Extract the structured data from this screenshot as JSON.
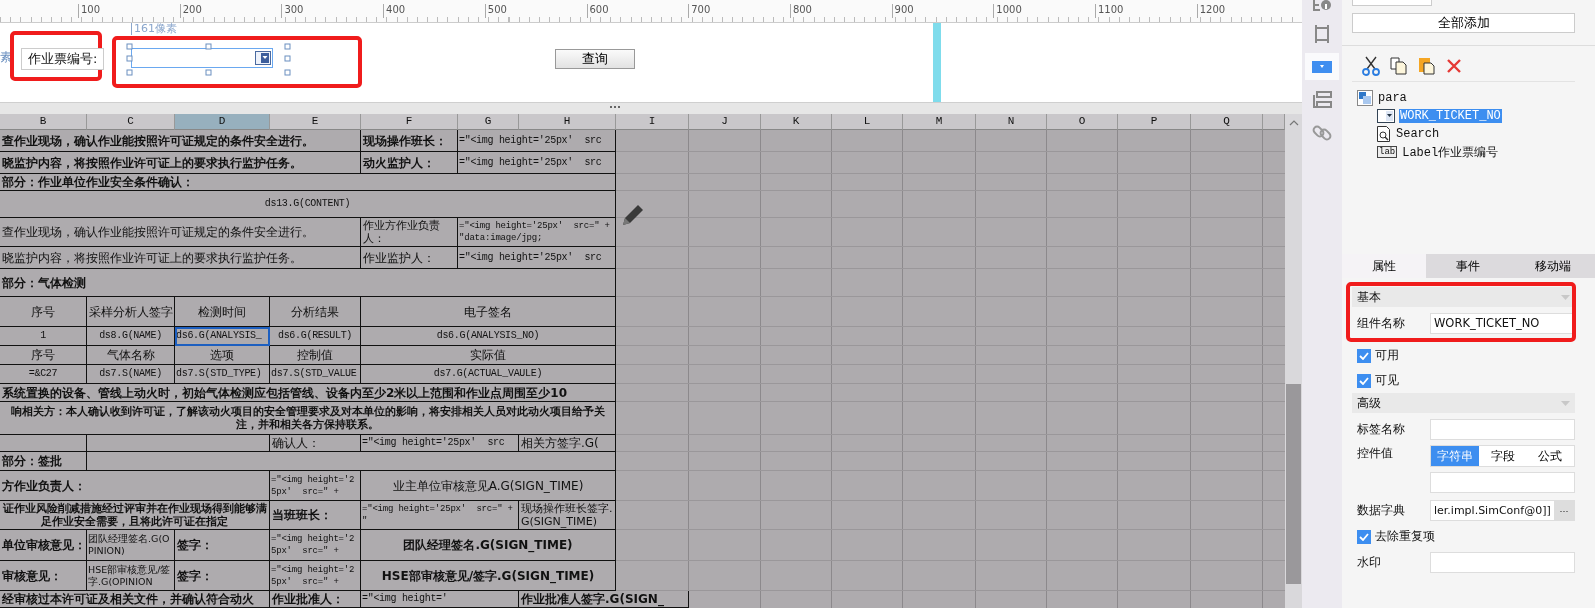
{
  "ruler": {
    "labels": [
      "100",
      "200",
      "300",
      "400",
      "500",
      "600",
      "700",
      "800",
      "900",
      "1000",
      "1100",
      "1200"
    ]
  },
  "canvas": {
    "cut_text": "素",
    "width_hint": "161像素",
    "label": "作业票编号:",
    "button": "查询"
  },
  "sheet": {
    "columns": [
      {
        "label": "B",
        "selected": false
      },
      {
        "label": "C",
        "selected": false
      },
      {
        "label": "D",
        "selected": true
      },
      {
        "label": "E",
        "selected": false
      },
      {
        "label": "F",
        "selected": false
      },
      {
        "label": "G",
        "selected": false
      },
      {
        "label": "H",
        "selected": false
      },
      {
        "label": "I",
        "selected": false
      },
      {
        "label": "J",
        "selected": false
      },
      {
        "label": "K",
        "selected": false
      },
      {
        "label": "L",
        "selected": false
      },
      {
        "label": "M",
        "selected": false
      },
      {
        "label": "N",
        "selected": false
      },
      {
        "label": "O",
        "selected": false
      },
      {
        "label": "P",
        "selected": false
      },
      {
        "label": "Q",
        "selected": false
      }
    ],
    "rows": [
      [
        {
          "text": "查作业现场，确认作业能按照许可证规定的条件安全进行。",
          "selected": false
        },
        {
          "text": "现场操作班长：",
          "selected": false
        },
        {
          "text": "=\"<img height='25px'  src",
          "selected": false
        }
      ],
      [
        {
          "text": "晓监护内容，将按照作业许可证上的要求执行监护任务。",
          "selected": false
        },
        {
          "text": "动火监护人：",
          "selected": false
        },
        {
          "text": "=\"<img height='25px'  src",
          "selected": false
        }
      ],
      [
        {
          "text": "部分：作业单位作业安全条件确认：",
          "selected": false
        }
      ],
      [
        {
          "text": "ds13.G(CONTENT)",
          "selected": false
        }
      ],
      [
        {
          "text": "查作业现场，确认作业能按照许可证规定的条件安全进行。",
          "selected": false
        },
        {
          "text": "作业方作业负责人：",
          "selected": false
        },
        {
          "text": "=\"<img height='25px'  src=\" + \"data:image/jpg;",
          "selected": false
        }
      ],
      [
        {
          "text": "晓监护内容，将按照作业许可证上的要求执行监护任务。",
          "selected": false
        },
        {
          "text": "作业监护人：",
          "selected": false
        },
        {
          "text": "=\"<img height='25px'  src",
          "selected": false
        }
      ],
      [
        {
          "text": "部分：气体检测",
          "selected": false
        }
      ],
      [
        {
          "text": "序号",
          "selected": false
        },
        {
          "text": "采样分析人签字",
          "selected": false
        },
        {
          "text": "检测时间",
          "selected": false
        },
        {
          "text": "分析结果",
          "selected": false
        },
        {
          "text": "电子签名",
          "selected": false
        }
      ],
      [
        {
          "text": "1",
          "selected": false
        },
        {
          "text": "ds8.G(NAME)",
          "selected": false
        },
        {
          "text": "ds6.G(ANALYSIS_",
          "selected": true
        },
        {
          "text": "ds6.G(RESULT)",
          "selected": false
        },
        {
          "text": "ds6.G(ANALYSIS_NO)",
          "selected": false
        }
      ],
      [
        {
          "text": "序号",
          "selected": false
        },
        {
          "text": "气体名称",
          "selected": false
        },
        {
          "text": "选项",
          "selected": false
        },
        {
          "text": "控制值",
          "selected": false
        },
        {
          "text": "实际值",
          "selected": false
        }
      ],
      [
        {
          "text": "=&C27",
          "selected": false
        },
        {
          "text": "ds7.S(NAME)",
          "selected": false
        },
        {
          "text": "ds7.S(STD_TYPE)",
          "selected": false
        },
        {
          "text": "ds7.S(STD_VALUE",
          "selected": false
        },
        {
          "text": "ds7.G(ACTUAL_VAULE)",
          "selected": false
        }
      ],
      [
        {
          "text": "系统置换的设备、管线上动火时，初始气体检测应包括管线、设备内至少2米以上范围和作业点周围至少10",
          "selected": false
        }
      ],
      [
        {
          "text": "响相关方：本人确认收到许可证，了解该动火项目的安全管理要求及对本单位的影响，将安排相关人员对此动火项目给予关注，并和相关各方保持联系。",
          "selected": false
        }
      ],
      [
        {
          "text": "确认人：",
          "selected": false
        },
        {
          "text": "=\"<img height='25px'  src",
          "selected": false
        },
        {
          "text": "相关方签字.G(",
          "selected": false
        }
      ],
      [
        {
          "text": "部分：签批",
          "selected": false
        }
      ],
      [
        {
          "text": "方作业负责人：",
          "selected": false
        },
        {
          "text": "=\"<img height='25px'  src=\" +",
          "selected": false
        },
        {
          "text": "业主单位审核意见A.G(SIGN_TIME)",
          "selected": false
        }
      ],
      [
        {
          "text": "证作业风险削减措施经过评审并在作业现场得到能够满足作业安全需要，且将此许可证在指定",
          "selected": false
        },
        {
          "text": "当班班长：",
          "selected": false
        },
        {
          "text": "=\"<img height='25px'  src=\" + \"",
          "selected": false
        },
        {
          "text": "现场操作班长签字.G(SIGN_TIME)",
          "selected": false
        }
      ],
      [
        {
          "text": "单位审核意见：",
          "selected": false
        },
        {
          "text": "团队经理签名.G(OPINION)",
          "selected": false
        },
        {
          "text": "签字：",
          "selected": false
        },
        {
          "text": "=\"<img height='25px'  src=\" +",
          "selected": false
        },
        {
          "text": "团队经理签名.G(SIGN_TIME)",
          "selected": false
        }
      ],
      [
        {
          "text": "审核意见：",
          "selected": false
        },
        {
          "text": "HSE部审核意见/签字.G(OPINION",
          "selected": false
        },
        {
          "text": "签字：",
          "selected": false
        },
        {
          "text": "=\"<img height='25px'  src=\" +",
          "selected": false
        },
        {
          "text": "HSE部审核意见/签字.G(SIGN_TIME)",
          "selected": false
        }
      ],
      [
        {
          "text": "经审核过本许可证及相关文件，并确认符合动火",
          "selected": false
        },
        {
          "text": "作业批准人：",
          "selected": false
        },
        {
          "text": "=\"<img height='",
          "selected": false
        },
        {
          "text": "作业批准人签字.G(SIGN_",
          "selected": false
        }
      ]
    ]
  },
  "side_icons": [
    {
      "selected": false
    },
    {
      "selected": false
    },
    {
      "selected": true
    },
    {
      "selected": false
    },
    {
      "selected": false
    }
  ],
  "panel": {
    "add_all_button": "全部添加",
    "tree": {
      "root": "para",
      "children": [
        {
          "kind": "combo",
          "label": "WORK_TICKET_NO",
          "selected": true
        },
        {
          "kind": "search",
          "label": "Search",
          "selected": false
        },
        {
          "kind": "label",
          "label": "Label作业票编号",
          "icon_text": "lab",
          "selected": false
        }
      ]
    },
    "tabs": [
      {
        "label": "属性",
        "selected": true
      },
      {
        "label": "事件",
        "selected": false
      },
      {
        "label": "移动端",
        "selected": false
      }
    ],
    "properties": {
      "basic_title": "基本",
      "name_label": "组件名称",
      "name_value": "WORK_TICKET_NO",
      "checks": [
        {
          "label": "可用",
          "checked": true
        },
        {
          "label": "可见",
          "checked": true
        }
      ],
      "advanced_title": "高级",
      "tag_label": "标签名称",
      "value_label": "控件值",
      "value_modes": [
        {
          "label": "字符串",
          "selected": true
        },
        {
          "label": "字段",
          "selected": false
        },
        {
          "label": "公式",
          "selected": false
        }
      ],
      "dict_label": "数据字典",
      "dict_value": "ler.impl.SimConf@0]]",
      "dict_button": "···",
      "dedupe": {
        "label": "去除重复项",
        "checked": true
      },
      "watermark_label": "水印"
    }
  }
}
